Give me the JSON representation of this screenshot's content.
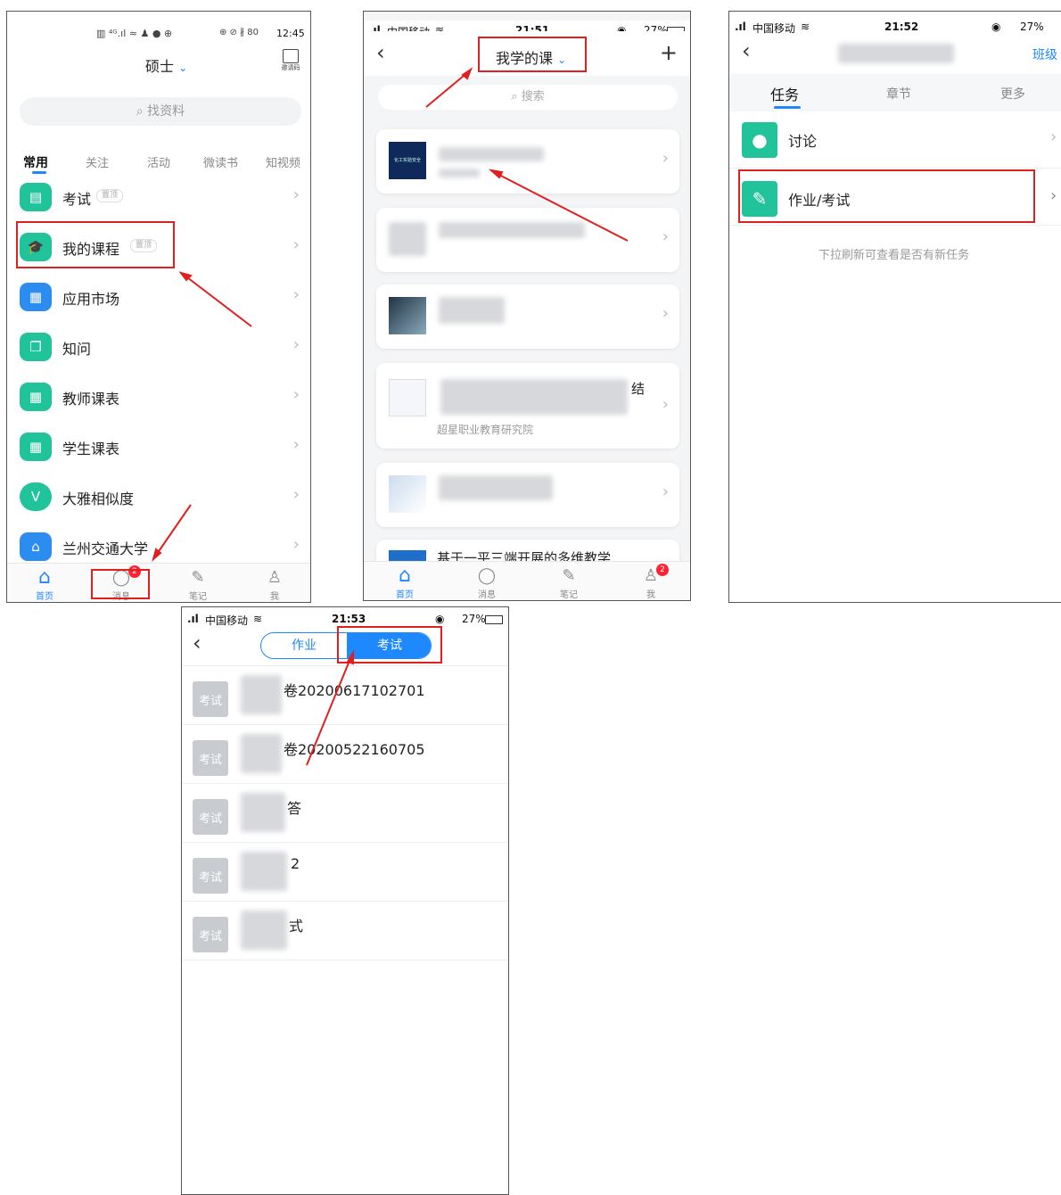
{
  "phone1": {
    "status_time": "12:45",
    "status_left": "▥ ⁴ᴳ.ıl ≈ ♟ ● ⊕",
    "status_right": "⊕ ⊘ ∦ 80",
    "header_title": "硕士",
    "scan_label": "邀请码",
    "search_placeholder": "找资料",
    "filter_tabs": [
      "常用",
      "关注",
      "活动",
      "微读书",
      "知视频"
    ],
    "items": [
      {
        "label": "考试",
        "tag": "置顶",
        "icon": "exam-icon",
        "color": "#21c49a"
      },
      {
        "label": "我的课程",
        "tag": "置顶",
        "icon": "graduation-cap-icon",
        "color": "#21c49a"
      },
      {
        "label": "应用市场",
        "tag": "",
        "icon": "app-grid-icon",
        "color": "#2d8cf0"
      },
      {
        "label": "知问",
        "tag": "",
        "icon": "qa-icon",
        "color": "#21c49a"
      },
      {
        "label": "教师课表",
        "tag": "",
        "icon": "calendar-icon",
        "color": "#21c49a"
      },
      {
        "label": "学生课表",
        "tag": "",
        "icon": "calendar-icon",
        "color": "#21c49a"
      },
      {
        "label": "大雅相似度",
        "tag": "",
        "icon": "similarity-icon",
        "color": "#21c49a"
      },
      {
        "label": "兰州交通大学",
        "tag": "",
        "icon": "home-icon",
        "color": "#2d8cf0"
      }
    ],
    "tabbar": [
      {
        "label": "首页",
        "icon": "home-icon"
      },
      {
        "label": "消息",
        "icon": "chat-bubble-icon"
      },
      {
        "label": "笔记",
        "icon": "note-icon"
      },
      {
        "label": "我",
        "icon": "person-icon"
      }
    ],
    "message_badge": "2"
  },
  "phone2": {
    "carrier": "中国移动",
    "status_time": "21:51",
    "battery": "27%",
    "title": "我学的课",
    "search_placeholder": "搜索",
    "course_thumb_text": "化工实验安全",
    "course_fragment_1": "结",
    "course_org": "超星职业教育研究院",
    "course_fragment_2": "基于一平三端开展的多维教学",
    "tabbar": [
      {
        "label": "首页",
        "icon": "home-icon"
      },
      {
        "label": "消息",
        "icon": "chat-bubble-icon"
      },
      {
        "label": "笔记",
        "icon": "note-icon"
      },
      {
        "label": "我",
        "icon": "person-icon"
      }
    ],
    "me_badge": "2"
  },
  "phone3": {
    "carrier": "中国移动",
    "status_time": "21:52",
    "battery": "27%",
    "class_link": "班级",
    "tabs": [
      "任务",
      "章节",
      "更多"
    ],
    "items": [
      {
        "label": "讨论",
        "icon": "discussion-icon"
      },
      {
        "label": "作业/考试",
        "icon": "homework-icon"
      }
    ],
    "hint": "下拉刷新可查看是否有新任务"
  },
  "phone4": {
    "carrier": "中国移动",
    "status_time": "21:53",
    "battery": "27%",
    "segment": [
      "作业",
      "考试"
    ],
    "badge_label": "考试",
    "rows": [
      "卷20200617102701",
      "卷20200522160705",
      "答",
      "2",
      "式"
    ]
  }
}
